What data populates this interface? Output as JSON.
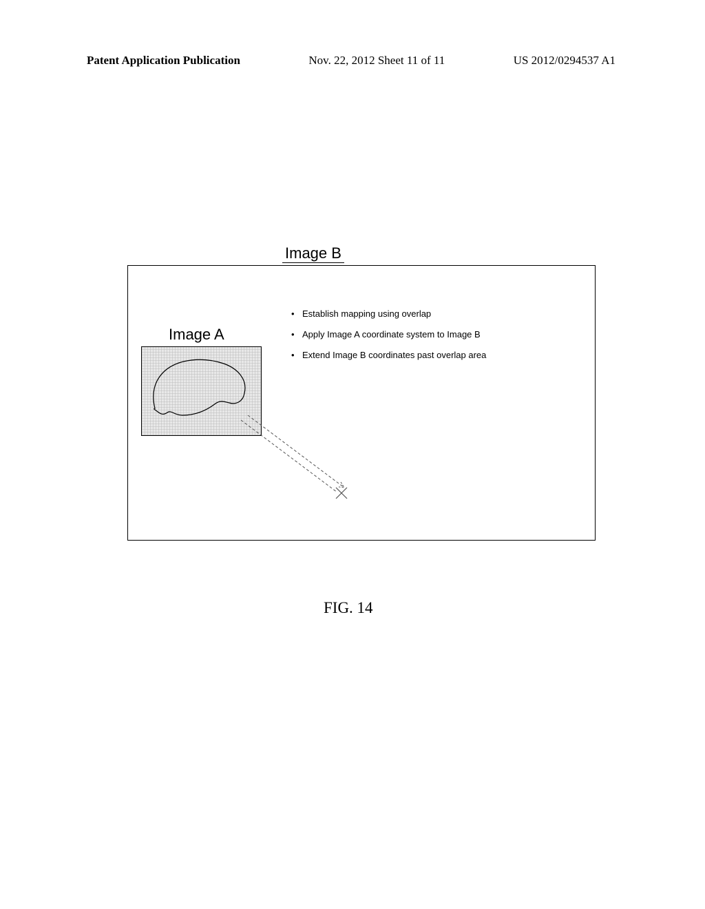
{
  "header": {
    "left": "Patent Application Publication",
    "center": "Nov. 22, 2012  Sheet 11 of 11",
    "right": "US 2012/0294537 A1"
  },
  "figure": {
    "image_b_label": "Image B",
    "image_a_label": "Image A",
    "bullets": [
      "Establish mapping using overlap",
      "Apply Image A coordinate system to Image B",
      "Extend Image B coordinates past overlap area"
    ],
    "caption": "FIG. 14"
  }
}
